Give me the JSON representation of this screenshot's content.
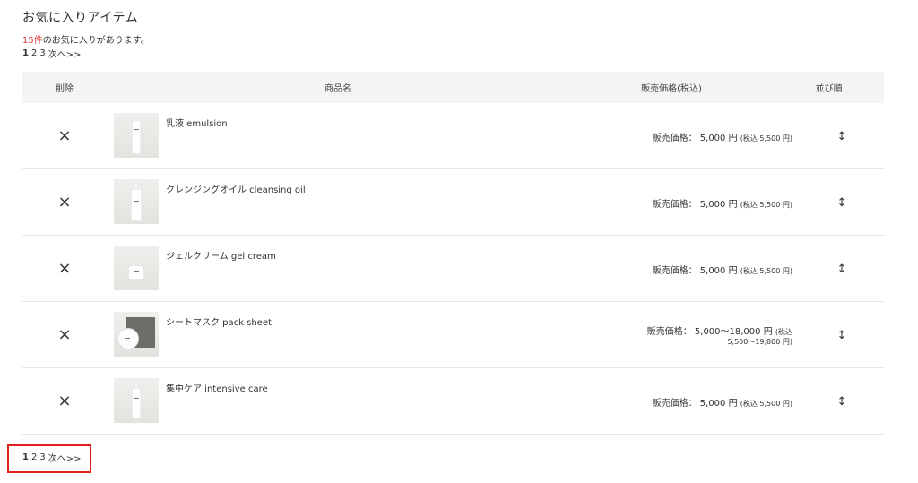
{
  "page": {
    "title": "お気に入りアイテム",
    "count_number": "15件",
    "count_suffix": "のお気に入りがあります。"
  },
  "pagination": {
    "current": "1",
    "pages": [
      "2",
      "3"
    ],
    "next": "次へ>>"
  },
  "table": {
    "headers": {
      "delete": "削除",
      "name": "商品名",
      "price": "販売価格(税込)",
      "order": "並び順"
    },
    "delete_icon": "×",
    "order_icon": "↕",
    "rows": [
      {
        "name": "乳液 emulsion",
        "price_line1": "販売価格： 5,000 円 ",
        "tax": "(税込 5,500 円)",
        "price_line2": ""
      },
      {
        "name": "クレンジングオイル cleansing oil",
        "price_line1": "販売価格： 5,000 円 ",
        "tax": "(税込 5,500 円)",
        "price_line2": ""
      },
      {
        "name": "ジェルクリーム gel cream",
        "price_line1": "販売価格： 5,000 円 ",
        "tax": "(税込 5,500 円)",
        "price_line2": ""
      },
      {
        "name": "シートマスク pack sheet",
        "price_line1": "販売価格： 5,000〜18,000 円 ",
        "tax": "(税込",
        "price_line2": "5,500〜19,800 円)"
      },
      {
        "name": "集中ケア intensive care",
        "price_line1": "販売価格： 5,000 円 ",
        "tax": "(税込 5,500 円)",
        "price_line2": ""
      }
    ]
  },
  "colors": {
    "accent_red": "#e53935",
    "highlight_border": "#e0201c",
    "header_bg": "#f4f4f3"
  }
}
